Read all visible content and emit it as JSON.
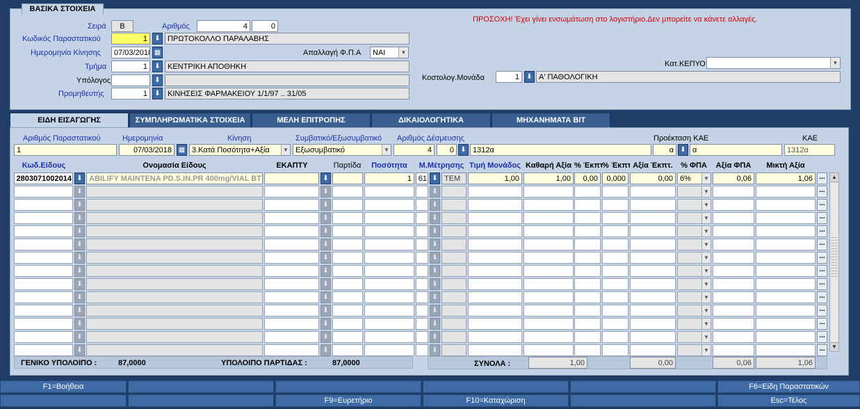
{
  "top": {
    "title": "ΒΑΣΙΚΑ ΣΤΟΙΧΕΙΑ",
    "warning": "ΠΡΟΣΟΧΗ! Έχει γίνει ενσωμάτωση στο λογιστήριο.Δεν μπορείτε να κάνετε αλλαγές.",
    "seira_label": "Σειρά",
    "seira_value": "Β",
    "arithmos_label": "Αριθμός",
    "arithmos_value": "4",
    "arithmos_value2": "0",
    "kodikos_label": "Κωδικός Παραστατικού",
    "kodikos_value": "1",
    "kodikos_desc": "ΠΡΩΤΟΚΟΛΛΟ ΠΑΡΑΛΑΒΗΣ",
    "imerominia_label": "Ημερομηνία Κίνησης",
    "imerominia_value": "07/03/2018",
    "apallagi_label": "Απαλλαγή Φ.Π.Α",
    "apallagi_value": "ΝΑΙ",
    "tmima_label": "Τμήμα",
    "tmima_value": "1",
    "tmima_desc": "ΚΕΝΤΡΙΚΗ ΑΠΟΘΗΚΗ",
    "ypologos_label": "Υπόλογος",
    "ypologos_value": "",
    "promitheftis_label": "Προμηθευτής",
    "promitheftis_value": "1",
    "promitheftis_desc": "ΚΙΝΗΣΕΙΣ ΦΑΡΜΑΚΕΙΟΥ 1/1/97 .. 31/05",
    "katkepyo_label": "Κατ.ΚΕΠΥΟ",
    "katkepyo_value": "",
    "kostolog_label": "Κοστολογ.Μονάδα",
    "kostolog_value": "1",
    "kostolog_desc": "Α' ΠΑΘΟΛΟΓΙΚΗ"
  },
  "tabs": [
    "ΕΙΔΗ ΕΙΣΑΓΩΓΗΣ",
    "ΣΥΜΠΛΗΡΩΜΑΤΙΚΑ ΣΤΟΙΧΕΙΑ",
    "ΜΕΛΗ ΕΠΙΤΡΟΠΗΣ",
    "ΔΙΚΑΙΟΛΟΓΗΤΙΚΑ",
    "ΜΗΧΑΝΗΜΑΤΑ ΒΙΤ"
  ],
  "doc": {
    "arith_par_label": "Αριθμός  Παραστατικού",
    "arith_par_value": "1",
    "imerom_label": "Ημερομηνία",
    "imerom_value": "07/03/2018",
    "kinisi_label": "Κίνηση",
    "kinisi_value": "3.Κατά Ποσότητα+Αξία",
    "symv_label": "Συμβατικό/Εξωσυμβατικό",
    "symv_value": "Εξωσυμβατικό",
    "desm_label": "Αριθμός Δέσμευσης",
    "desm_value1": "4",
    "desm_value2": "0",
    "desm_desc": "1312α",
    "proekt_label": "Προέκταση ΚΑΕ",
    "proekt_value": "α",
    "proekt_desc": "α",
    "kae_label": "ΚΑΕ",
    "kae_value": "1312α"
  },
  "table": {
    "headers": [
      "Κωδ.Είδους",
      "Ονομασία Είδους",
      "ΕΚΑΠΤΥ",
      "Παρτίδα",
      "Ποσότητα",
      "Μ.Μέτρησης",
      "Τιμή Μονάδος",
      "Καθαρή Αξία",
      "% Έκπτ",
      "% Έκπτ.",
      "Αξία Έκπτ.",
      "% ΦΠΑ",
      "Αξία  ΦΠΑ",
      "Μικτή Αξία"
    ],
    "row1": {
      "code": "2803071002014",
      "name": "ABILIFY MAINTENA PD.S.IN.PR 400mg/VIAL BTX",
      "ekaptu": "",
      "partida": "",
      "posotita": "1",
      "mm_code": "61",
      "mm_desc": "TEM",
      "timi": "1,00",
      "kathari": "1,00",
      "ekpt1": "0,00",
      "ekpt2": "0,000",
      "axia_ekpt": "0,00",
      "fpa": "6%",
      "axia_fpa": "0,06",
      "mikti": "1,06",
      "more": "..."
    },
    "more_btn": "..."
  },
  "footer": {
    "geniko_label": "ΓΕΝΙΚΟ ΥΠΟΛΟΙΠΟ :",
    "geniko_value": "87,0000",
    "partidas_label": "ΥΠΟΛΟΙΠΟ ΠΑΡΤΙΔΑΣ :",
    "partidas_value": "87,0000",
    "synola_label": "ΣΥΝΟΛΑ :",
    "synola_kathari": "1,00",
    "synola_ekpt": "0,00",
    "synola_fpa": "0,06",
    "synola_mikti": "1,06"
  },
  "fkeys": {
    "f1": "F1=Βοήθεια",
    "f6": "F6=Είδη Παραστατικών",
    "f9": "F9=Ευρετήριο",
    "f10": "F10=Καταχώριση",
    "esc": "Esc=Τέλος"
  }
}
